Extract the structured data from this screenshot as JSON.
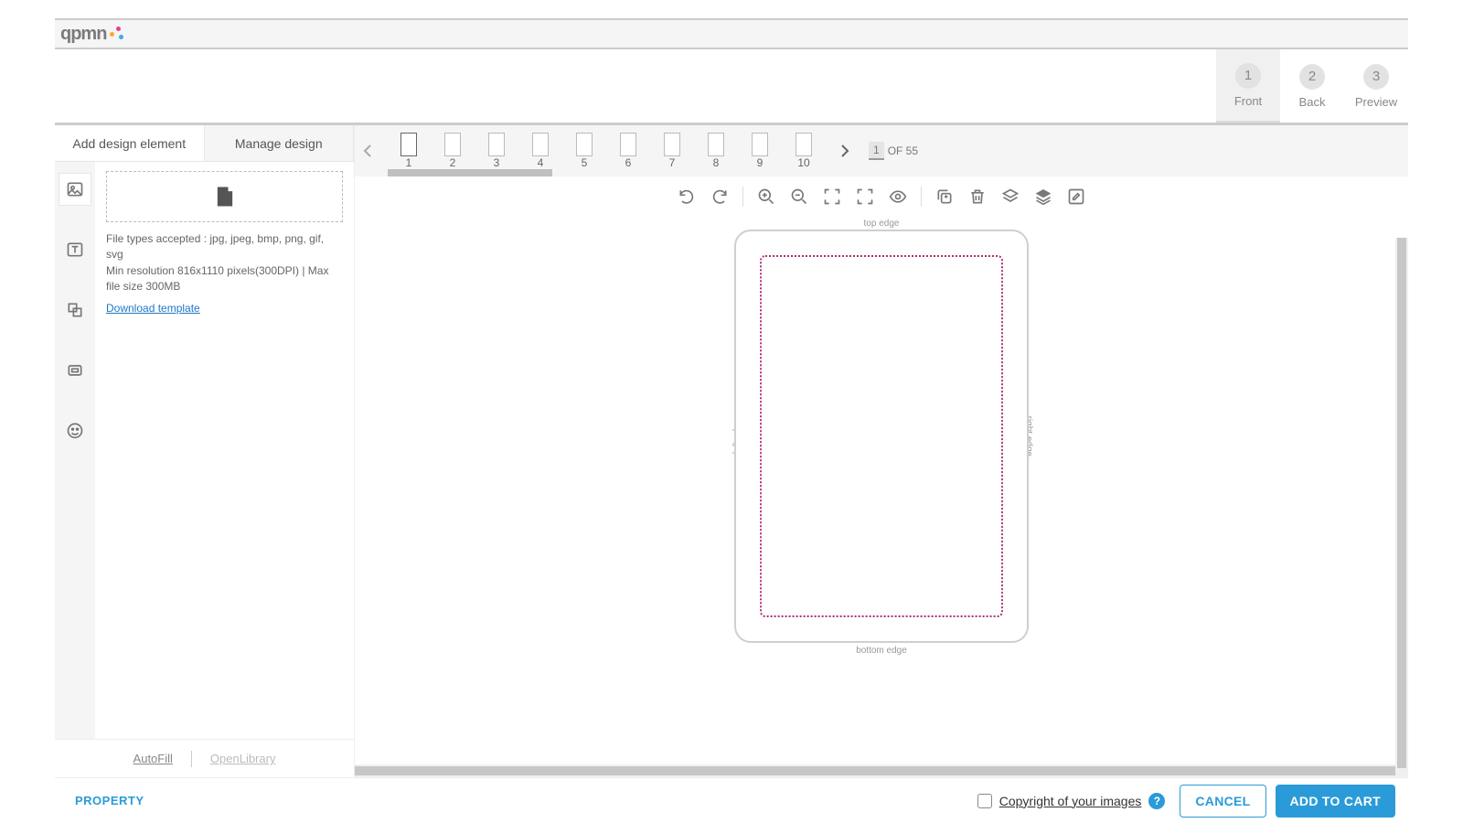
{
  "logo_text": "qpmn",
  "steps": [
    {
      "num": "1",
      "label": "Front"
    },
    {
      "num": "2",
      "label": "Back"
    },
    {
      "num": "3",
      "label": "Preview"
    }
  ],
  "tabs": {
    "add": "Add design element",
    "manage": "Manage design"
  },
  "upload": {
    "file_types": "File types accepted : jpg, jpeg, bmp, png, gif, svg",
    "resolution": "Min resolution 816x1110 pixels(300DPI) | Max file size 300MB",
    "download_template": "Download template"
  },
  "left_footer": {
    "autofill": "AutoFill",
    "openlibrary": "OpenLibrary"
  },
  "pages": {
    "labels": [
      "1",
      "2",
      "3",
      "4",
      "5",
      "6",
      "7",
      "8",
      "9",
      "10"
    ],
    "current": "1",
    "of_label": "OF 55"
  },
  "edges": {
    "top": "top edge",
    "bottom": "bottom edge",
    "left": "left edge",
    "right": "right edge"
  },
  "bottom": {
    "property": "PROPERTY",
    "copyright": "Copyright of your images",
    "cancel": "CANCEL",
    "add_to_cart": "ADD TO CART",
    "help": "?"
  }
}
